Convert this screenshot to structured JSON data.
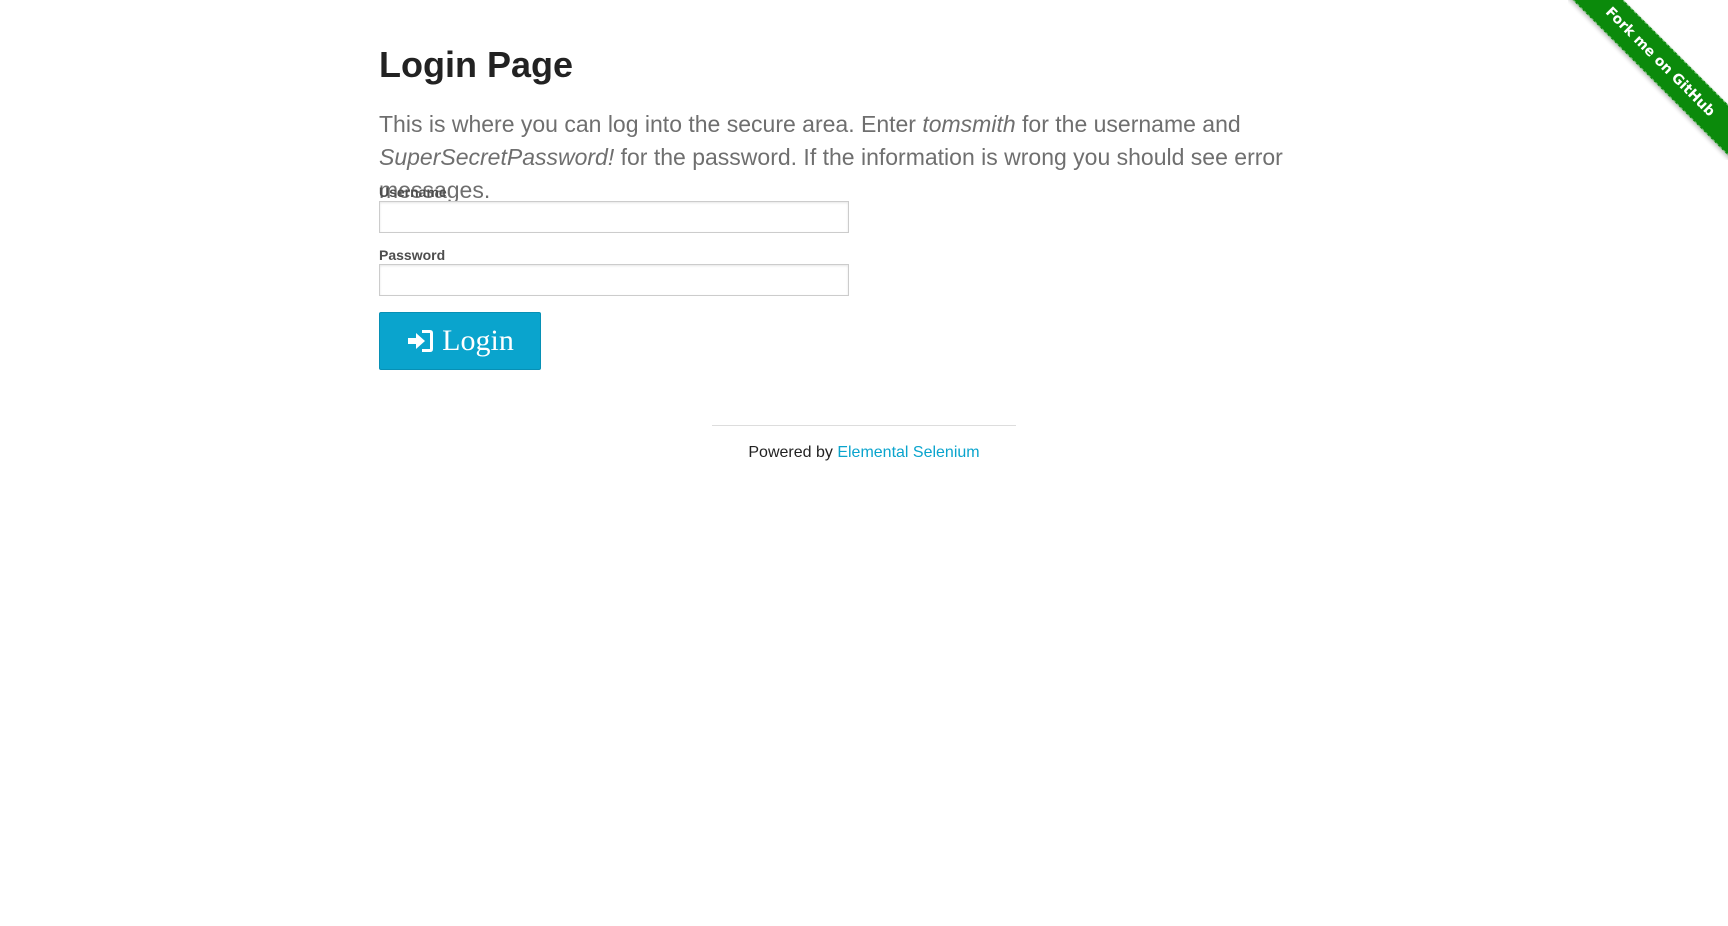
{
  "ribbon": {
    "label": "Fork me on GitHub",
    "color": "#0b8a0b"
  },
  "page": {
    "title": "Login Page",
    "intro_part1": "This is where you can log into the secure area. Enter ",
    "intro_username": "tomsmith",
    "intro_part2": " for the username and ",
    "intro_password": "SuperSecretPassword!",
    "intro_part3": " for the password. If the information is wrong you should see error messages."
  },
  "form": {
    "username_label": "Username",
    "username_value": "",
    "password_label": "Password",
    "password_value": "",
    "login_label": "Login",
    "login_icon": "sign-in-icon",
    "button_color": "#0aa4cd"
  },
  "footer": {
    "prefix": "Powered by ",
    "link_label": "Elemental Selenium",
    "link_color": "#0aa4cd"
  }
}
